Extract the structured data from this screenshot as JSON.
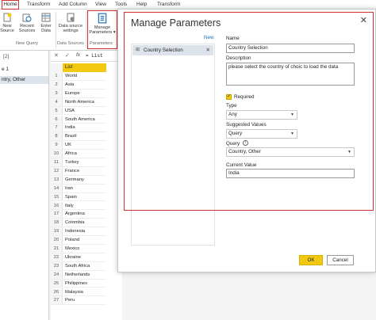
{
  "ribbon": {
    "tabs": [
      "Home",
      "Transform",
      "Add Column",
      "View",
      "Tools",
      "Help",
      "Transform"
    ],
    "buttons": {
      "new_source": "New Source",
      "recent_sources": "Recent Sources",
      "enter_data": "Enter Data",
      "data_source_settings": "Data source settings",
      "manage_parameters": "Manage Parameters"
    },
    "groups": {
      "new_query": "New Query",
      "data_sources": "Data Sources",
      "parameters": "Parameters"
    }
  },
  "left_pane": {
    "count": "[2]",
    "query_1": "e 1",
    "query_2": "ntry, Other"
  },
  "formula_bar": {
    "fx": "fx",
    "text": "= List"
  },
  "grid": {
    "header": "List",
    "rows": [
      {
        "n": "1",
        "v": "World"
      },
      {
        "n": "2",
        "v": "Asia"
      },
      {
        "n": "3",
        "v": "Europe"
      },
      {
        "n": "4",
        "v": "North America"
      },
      {
        "n": "5",
        "v": "USA"
      },
      {
        "n": "6",
        "v": "South America"
      },
      {
        "n": "7",
        "v": "India"
      },
      {
        "n": "8",
        "v": "Brazil"
      },
      {
        "n": "9",
        "v": "UK"
      },
      {
        "n": "10",
        "v": "Africa"
      },
      {
        "n": "11",
        "v": "Turkey"
      },
      {
        "n": "12",
        "v": "France"
      },
      {
        "n": "13",
        "v": "Germany"
      },
      {
        "n": "14",
        "v": "Iran"
      },
      {
        "n": "15",
        "v": "Spain"
      },
      {
        "n": "16",
        "v": "Italy"
      },
      {
        "n": "17",
        "v": "Argentina"
      },
      {
        "n": "18",
        "v": "Colombia"
      },
      {
        "n": "19",
        "v": "Indonesia"
      },
      {
        "n": "20",
        "v": "Poland"
      },
      {
        "n": "21",
        "v": "Mexico"
      },
      {
        "n": "22",
        "v": "Ukraine"
      },
      {
        "n": "23",
        "v": "South Africa"
      },
      {
        "n": "24",
        "v": "Netherlands"
      },
      {
        "n": "25",
        "v": "Philippines"
      },
      {
        "n": "26",
        "v": "Malaysia"
      },
      {
        "n": "27",
        "v": "Peru"
      }
    ]
  },
  "dialog": {
    "title": "Manage Parameters",
    "new_link": "New",
    "parameter_item": "Country Selection",
    "name_label": "Name",
    "name_value": "Country Selection",
    "description_label": "Description",
    "description_value": "please select the country of choic to load the data",
    "required_label": "Required",
    "type_label": "Type",
    "type_value": "Any",
    "suggested_label": "Suggested Values",
    "suggested_value": "Query",
    "query_label": "Query",
    "query_value": "Country, Other",
    "current_label": "Current Value",
    "current_value": "India",
    "ok_label": "OK",
    "cancel_label": "Cancel"
  },
  "colors": {
    "highlight_red": "#d3302f",
    "ok_yellow": "#f2c811",
    "list_header_yellow": "#f2c811",
    "link_blue": "#1f6bb5"
  }
}
